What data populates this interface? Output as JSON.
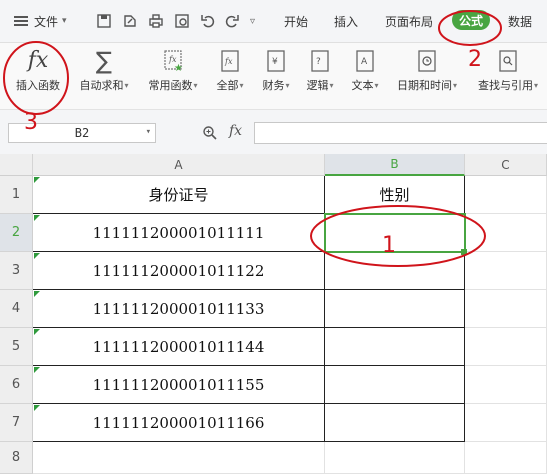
{
  "topbar": {
    "file_menu": "文件",
    "tabs": [
      "开始",
      "插入",
      "页面布局",
      "公式",
      "数据"
    ],
    "active_tab": "公式",
    "accent_color": "#48a541"
  },
  "ribbon": {
    "items": [
      {
        "label": "插入函数",
        "icon": "fx-icon"
      },
      {
        "label": "自动求和",
        "icon": "sigma-icon"
      },
      {
        "label": "常用函数",
        "icon": "star-fx-icon"
      },
      {
        "label": "全部",
        "icon": "fx-book-icon"
      },
      {
        "label": "财务",
        "icon": "yen-book-icon"
      },
      {
        "label": "逻辑",
        "icon": "question-book-icon"
      },
      {
        "label": "文本",
        "icon": "text-book-icon"
      },
      {
        "label": "日期和时间",
        "icon": "clock-book-icon"
      },
      {
        "label": "查找与引用",
        "icon": "search-book-icon"
      }
    ]
  },
  "formula_bar": {
    "name_box": "B2",
    "fx_label": "fx"
  },
  "sheet": {
    "columns": [
      "A",
      "B",
      "C"
    ],
    "rows": [
      "1",
      "2",
      "3",
      "4",
      "5",
      "6",
      "7",
      "8"
    ],
    "header_row": [
      "身份证号",
      "性别"
    ],
    "id_values": [
      "111111200001011111",
      "111111200001011122",
      "111111200001011133",
      "111111200001011144",
      "111111200001011155",
      "111111200001011166"
    ],
    "selected_cell": "B2"
  },
  "annotations": [
    "1",
    "2",
    "3"
  ],
  "annotation_color": "#d0141b"
}
